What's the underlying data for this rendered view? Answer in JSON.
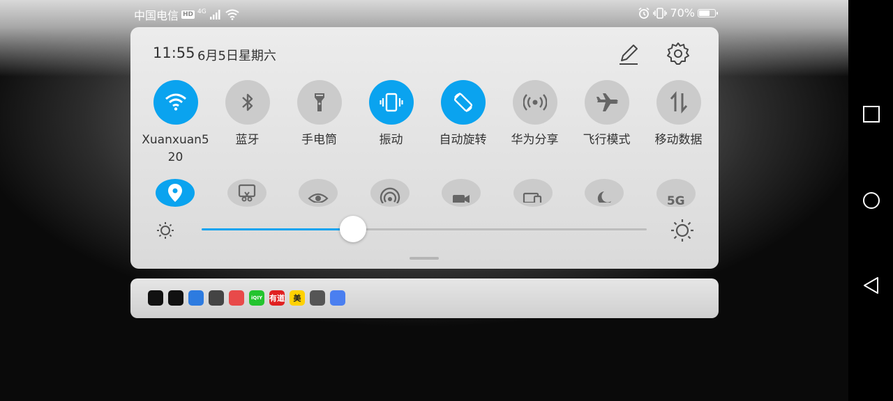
{
  "status_bar": {
    "carrier": "中国电信",
    "hd_badge": "HD",
    "network_type": "4G",
    "battery_percent": "70%",
    "battery_level": 0.7,
    "icons": [
      "signal-icon",
      "wifi-icon",
      "alarm-icon",
      "vibrate-icon",
      "battery-icon"
    ]
  },
  "header": {
    "time": "11:55",
    "date": "6月5日星期六",
    "edit_icon": "pencil-icon",
    "settings_icon": "gear-icon"
  },
  "tiles_row1": [
    {
      "label": "Xuanxuan520",
      "icon": "wifi-icon",
      "active": true
    },
    {
      "label": "蓝牙",
      "icon": "bluetooth-icon",
      "active": false
    },
    {
      "label": "手电筒",
      "icon": "flashlight-icon",
      "active": false
    },
    {
      "label": "振动",
      "icon": "vibrate-icon",
      "active": true
    },
    {
      "label": "自动旋转",
      "icon": "auto-rotate-icon",
      "active": true
    },
    {
      "label": "华为分享",
      "icon": "share-icon",
      "active": false
    },
    {
      "label": "飞行模式",
      "icon": "airplane-icon",
      "active": false
    },
    {
      "label": "移动数据",
      "icon": "mobile-data-icon",
      "active": false
    }
  ],
  "tiles_row2": [
    {
      "icon": "location-icon",
      "active": true
    },
    {
      "icon": "screenshot-icon",
      "active": false
    },
    {
      "icon": "eye-comfort-icon",
      "active": false
    },
    {
      "icon": "hotspot-icon",
      "active": false
    },
    {
      "icon": "screen-record-icon",
      "active": false
    },
    {
      "icon": "multi-screen-icon",
      "active": false
    },
    {
      "icon": "dark-mode-icon",
      "active": false
    },
    {
      "icon": "5g-icon",
      "label": "5G",
      "active": false
    }
  ],
  "brightness": {
    "level": 0.34,
    "low_icon": "sun-low-icon",
    "high_icon": "sun-high-icon",
    "accent": "#0aa3ef"
  },
  "notification_icons": [
    {
      "name": "capcut-icon",
      "color": "#111111"
    },
    {
      "name": "tiktok-icon",
      "color": "#111111"
    },
    {
      "name": "browser-icon",
      "color": "#2d7be0"
    },
    {
      "name": "qq-icon",
      "color": "#444444"
    },
    {
      "name": "reader-icon",
      "color": "#e84a4a"
    },
    {
      "name": "iqiyi-icon",
      "color": "#23c42e",
      "text": "iQIY"
    },
    {
      "name": "youdao-icon",
      "color": "#e02020",
      "text": "有道"
    },
    {
      "name": "meituan-icon",
      "color": "#ffd100",
      "text": "美"
    },
    {
      "name": "wechat-icon",
      "color": "#555555"
    },
    {
      "name": "music-icon",
      "color": "#4a7ff0"
    }
  ],
  "nav": [
    "recent-apps-icon",
    "home-icon",
    "back-icon"
  ]
}
